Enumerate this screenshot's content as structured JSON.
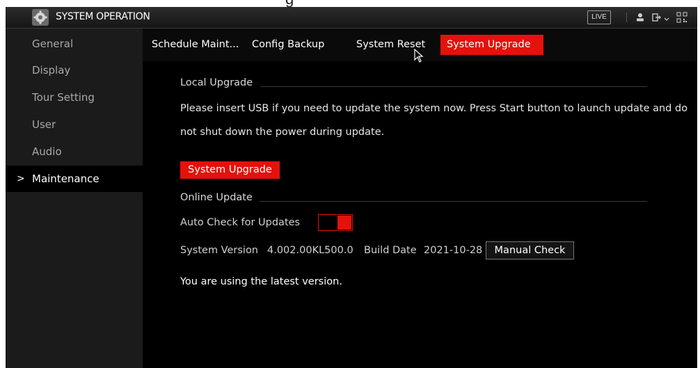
{
  "page_heading": "g",
  "app": {
    "title": "SYSTEM OPERATION",
    "live_label": "LIVE"
  },
  "icons": [
    "gear-icon",
    "user-icon",
    "logout-icon",
    "qr-code-icon",
    "mouse-cursor-icon",
    "chevron-right-icon"
  ],
  "sidebar": {
    "items": [
      {
        "label": "General"
      },
      {
        "label": "Display"
      },
      {
        "label": "Tour Setting"
      },
      {
        "label": "User"
      },
      {
        "label": "Audio"
      },
      {
        "label": "Maintenance",
        "active": true,
        "marker": ">"
      }
    ]
  },
  "tabs": [
    {
      "label": "Schedule Maint..."
    },
    {
      "label": "Config Backup"
    },
    {
      "label": "System Reset"
    },
    {
      "label": "System Upgrade",
      "active": true
    }
  ],
  "local_upgrade": {
    "heading": "Local Upgrade",
    "line1": "Please insert USB if you need to update the system now. Press Start button to launch update and do",
    "line2": "not shut down the power during update.",
    "button": "System Upgrade"
  },
  "online_update": {
    "heading": "Online Update",
    "auto_check_label": "Auto Check for Updates",
    "auto_check_enabled": true,
    "version_label": "System Version",
    "version_value": "4.002.00KL500.0",
    "build_label": "Build Date",
    "build_value": "2021-10-28",
    "manual_check_button": "Manual Check",
    "status": "You are using the latest version."
  },
  "colors": {
    "accent": "#e3120b",
    "sidebar_bg": "#1b1b1b",
    "background": "#000000"
  }
}
